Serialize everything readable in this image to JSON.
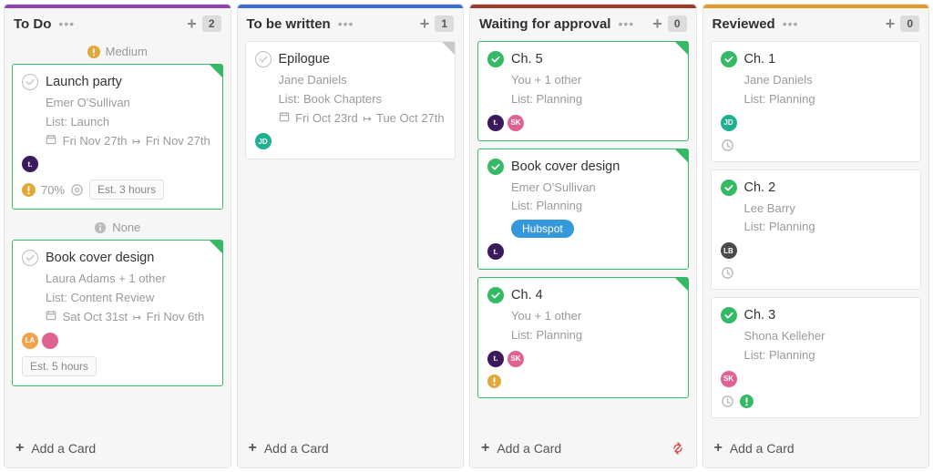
{
  "columns": {
    "todo": {
      "title": "To Do",
      "count": "2",
      "groups": {
        "medium": "Medium",
        "none": "None"
      },
      "cards": {
        "launch": {
          "title": "Launch party",
          "owner": "Emer O'Sullivan",
          "list": "List: Launch",
          "date_start": "Fri Nov 27th",
          "date_end": "Fri Nov 27th",
          "avatars": [
            {
              "label": "t.",
              "cls": "av-t"
            }
          ],
          "percent": "70%",
          "estimate": "Est. 3 hours"
        },
        "cover": {
          "title": "Book cover design",
          "owner": "Laura Adams + 1 other",
          "list": "List: Content Review",
          "date_start": "Sat Oct 31st",
          "date_end": "Fri Nov 6th",
          "avatars": [
            {
              "label": "LA",
              "cls": "av-la"
            },
            {
              "label": "",
              "cls": "av-pk"
            }
          ],
          "estimate": "Est. 5 hours"
        }
      }
    },
    "written": {
      "title": "To be written",
      "count": "1",
      "cards": {
        "epilogue": {
          "title": "Epilogue",
          "owner": "Jane Daniels",
          "list": "List: Book Chapters",
          "date_start": "Fri Oct 23rd",
          "date_end": "Tue Oct 27th",
          "avatars": [
            {
              "label": "JD",
              "cls": "av-jd"
            }
          ]
        }
      }
    },
    "waiting": {
      "title": "Waiting for approval",
      "count": "0",
      "cards": {
        "ch5": {
          "title": "Ch. 5",
          "owner": "You + 1 other",
          "list": "List: Planning",
          "avatars": [
            {
              "label": "t.",
              "cls": "av-t"
            },
            {
              "label": "SK",
              "cls": "av-sk"
            }
          ]
        },
        "cover": {
          "title": "Book cover design",
          "owner": "Emer O'Sullivan",
          "list": "List: Planning",
          "tag": "Hubspot",
          "avatars": [
            {
              "label": "t.",
              "cls": "av-t"
            }
          ]
        },
        "ch4": {
          "title": "Ch. 4",
          "owner": "You + 1 other",
          "list": "List: Planning",
          "avatars": [
            {
              "label": "t.",
              "cls": "av-t"
            },
            {
              "label": "SK",
              "cls": "av-sk"
            }
          ]
        }
      }
    },
    "reviewed": {
      "title": "Reviewed",
      "count": "0",
      "cards": {
        "ch1": {
          "title": "Ch. 1",
          "owner": "Jane Daniels",
          "list": "List: Planning",
          "avatars": [
            {
              "label": "JD",
              "cls": "av-jd"
            }
          ]
        },
        "ch2": {
          "title": "Ch. 2",
          "owner": "Lee Barry",
          "list": "List: Planning",
          "avatars": [
            {
              "label": "LB",
              "cls": "av-lb"
            }
          ]
        },
        "ch3": {
          "title": "Ch. 3",
          "owner": "Shona Kelleher",
          "list": "List: Planning",
          "avatars": [
            {
              "label": "SK",
              "cls": "av-sk"
            }
          ]
        }
      }
    }
  },
  "ui": {
    "add_card": "Add a Card"
  }
}
